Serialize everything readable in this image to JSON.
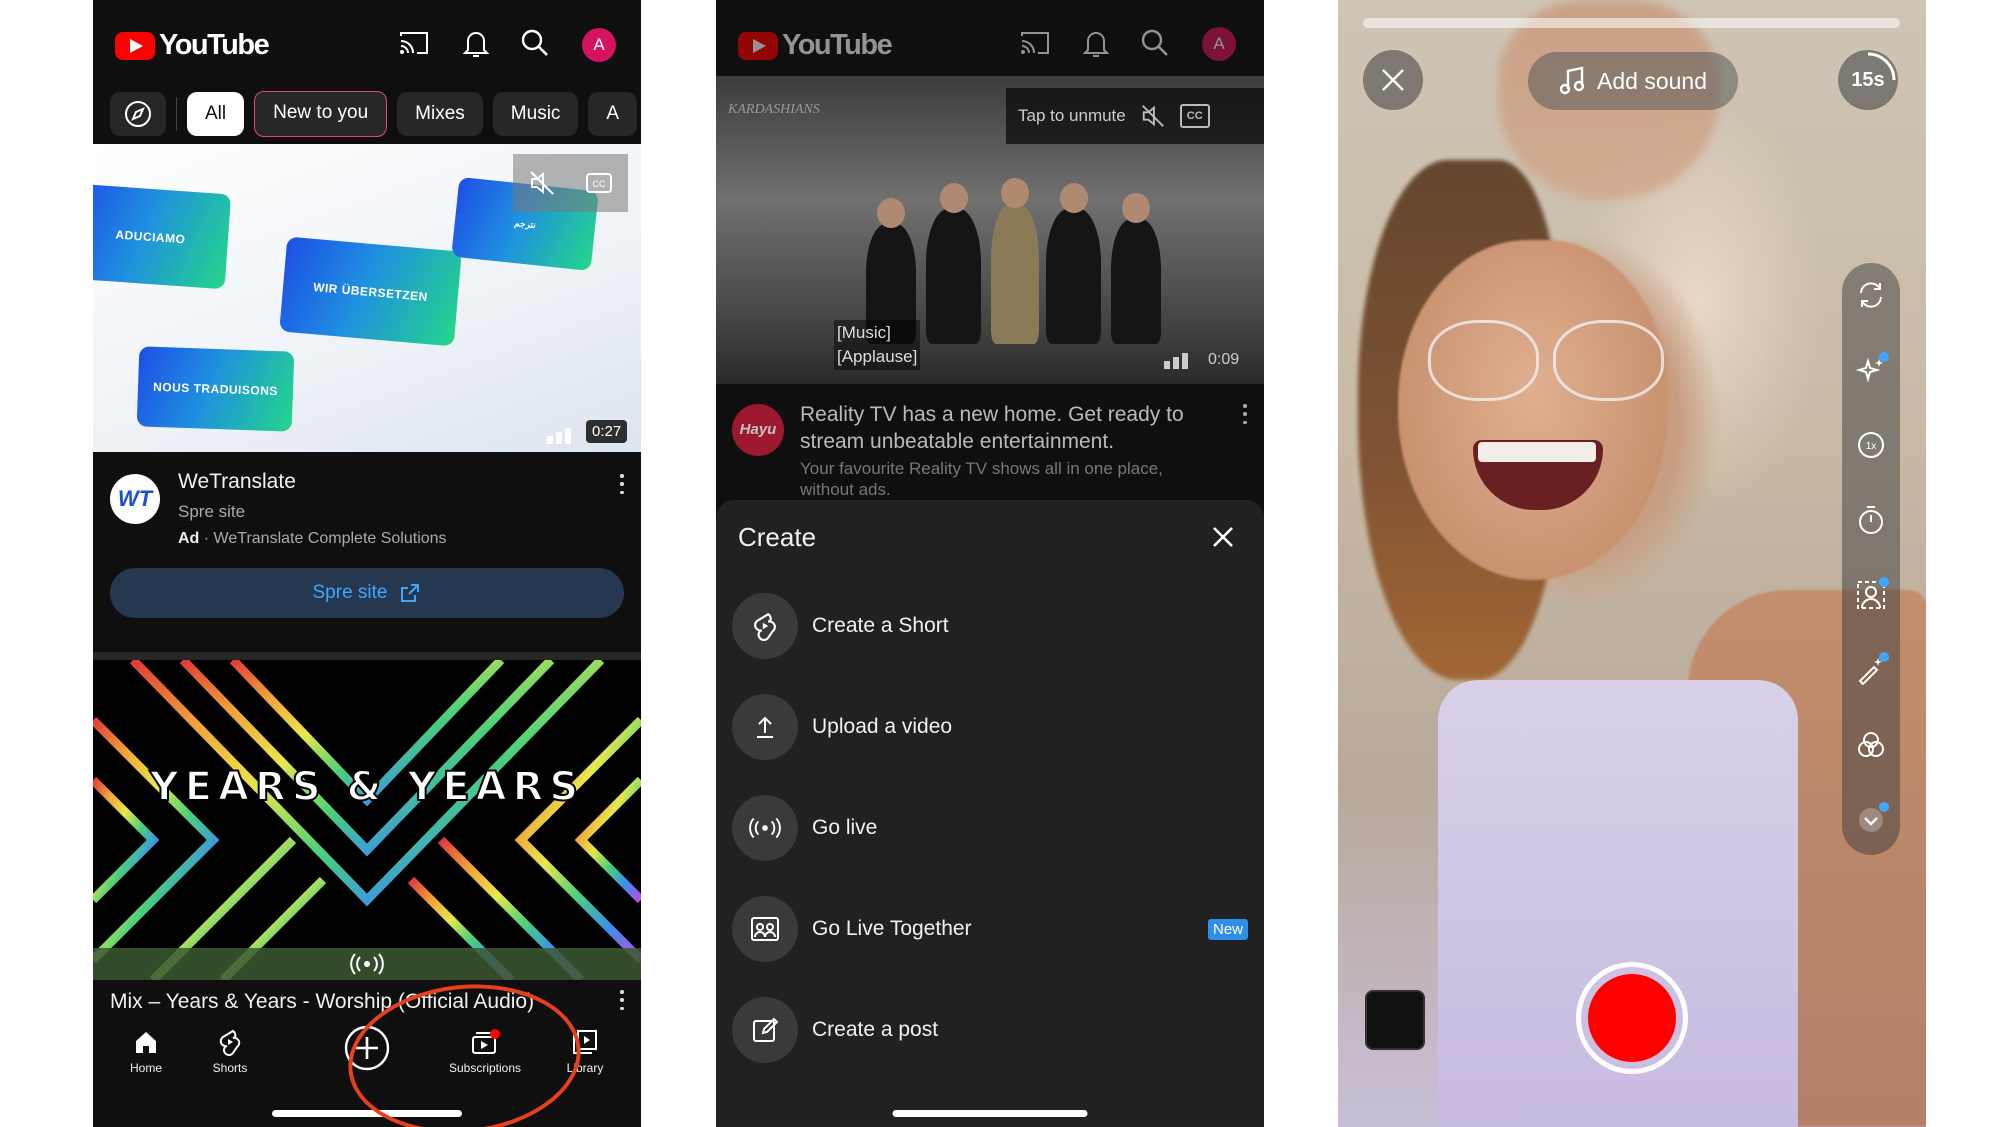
{
  "screen1": {
    "logo_text": "YouTube",
    "avatar_letter": "A",
    "chips": [
      "All",
      "New to you",
      "Mixes",
      "Music",
      "A"
    ],
    "ad": {
      "cards": [
        "ADUCIAMO",
        "WIR ÜBERSETZEN",
        "NOUS TRADUISONS",
        "نترجم"
      ],
      "duration": "0:27",
      "logo": "WT",
      "title": "WeTranslate",
      "subtitle": "Spre site",
      "ad_label": "Ad",
      "sponsor": "WeTranslate Complete Solutions",
      "cta_label": "Spre site"
    },
    "mix": {
      "thumb_text": "YEARS & YEARS",
      "title": "Mix – Years & Years - Worship (Official Audio)"
    },
    "nav": [
      "Home",
      "Shorts",
      "Subscriptions",
      "Library"
    ],
    "annotation_color": "#e8401c"
  },
  "screen2": {
    "logo_text": "YouTube",
    "avatar_letter": "A",
    "video": {
      "watermark": "KARDASHIANS",
      "unmute_label": "Tap to unmute",
      "cc": "CC",
      "caption_1": "[Music]",
      "caption_2": "[Applause]",
      "duration": "0:09"
    },
    "channel_logo": "Hayu",
    "title": "Reality TV has a new home. Get ready to stream unbeatable entertainment.",
    "description": "Your favourite Reality TV shows all in one place, without ads.",
    "sheet": {
      "title": "Create",
      "items": [
        "Create a Short",
        "Upload a video",
        "Go live",
        "Go Live Together",
        "Create a post"
      ],
      "badge": "New"
    }
  },
  "screen3": {
    "add_sound_label": "Add sound",
    "timer_label": "15s",
    "record_color": "#ff0000",
    "accent": "#3ea6ff",
    "rail_icons": [
      "flip-camera-icon",
      "effects-icon",
      "speed-icon",
      "timer-icon",
      "green-screen-icon",
      "retouch-icon",
      "filters-icon",
      "more-icon"
    ]
  }
}
